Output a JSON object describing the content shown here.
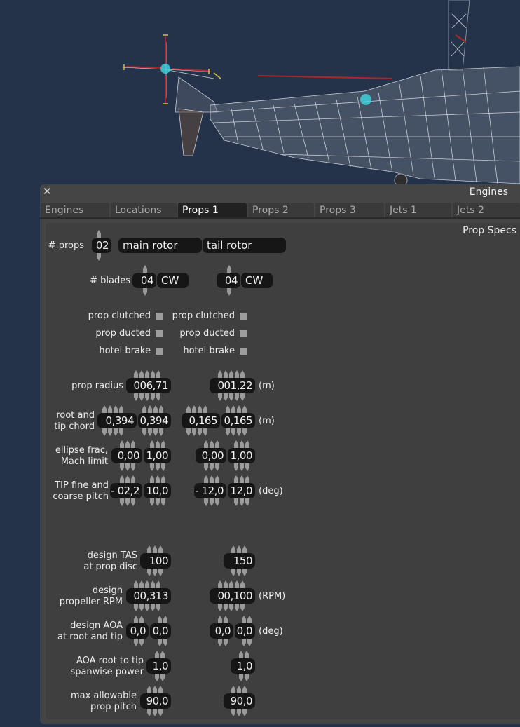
{
  "window": {
    "title": "Engines",
    "close_glyph": "✕"
  },
  "tabs": [
    {
      "label": "Engines",
      "active": false
    },
    {
      "label": "Locations",
      "active": false
    },
    {
      "label": "Props 1",
      "active": true
    },
    {
      "label": "Props 2",
      "active": false
    },
    {
      "label": "Props 3",
      "active": false
    },
    {
      "label": "Jets 1",
      "active": false
    },
    {
      "label": "Jets 2",
      "active": false
    }
  ],
  "panel": {
    "title": "Prop Specs"
  },
  "labels": {
    "num_props": "# props",
    "num_blades": "# blades",
    "prop_clutched": "prop clutched",
    "prop_ducted": "prop ducted",
    "hotel_brake": "hotel brake",
    "prop_radius": "prop radius",
    "chord_1": "root and",
    "chord_2": "tip chord",
    "ellipse_1": "ellipse frac,",
    "ellipse_2": "Mach limit",
    "pitch_1": "TIP fine and",
    "pitch_2": "coarse pitch",
    "tas_1": "design TAS",
    "tas_2": "at prop disc",
    "rpm_1": "design",
    "rpm_2": "propeller RPM",
    "aoa_1": "design AOA",
    "aoa_2": "at root and tip",
    "power_1": "AOA root to tip",
    "power_2": "spanwise power",
    "maxp_1": "max allowable",
    "maxp_2": "prop pitch"
  },
  "units": {
    "m1": "(m)",
    "m2": "(m)",
    "deg1": "(deg)",
    "rpm": "(RPM)",
    "deg2": "(deg)"
  },
  "num_props": "02",
  "props": [
    {
      "name": "main rotor",
      "blades": "04",
      "direction": "CW",
      "clutched": false,
      "ducted": false,
      "hotel_brake": false,
      "radius": "006,71",
      "root_chord": "0,394",
      "tip_chord": "0,394",
      "ellipse_frac": "0,00",
      "mach_limit": "1,00",
      "fine_pitch": "- 02,2",
      "coarse_pitch": "10,0",
      "design_tas": "100",
      "design_rpm": "00,313",
      "aoa_root": "0,0",
      "aoa_tip": "0,0",
      "spanwise_power": "1,0",
      "max_pitch": "90,0"
    },
    {
      "name": "tail rotor",
      "blades": "04",
      "direction": "CW",
      "clutched": false,
      "ducted": false,
      "hotel_brake": false,
      "radius": "001,22",
      "root_chord": "0,165",
      "tip_chord": "0,165",
      "ellipse_frac": "0,00",
      "mach_limit": "1,00",
      "fine_pitch": "- 12,0",
      "coarse_pitch": "12,0",
      "design_tas": "150",
      "design_rpm": "00,100",
      "aoa_root": "0,0",
      "aoa_tip": "0,0",
      "spanwise_power": "1,0",
      "max_pitch": "90,0"
    }
  ],
  "colors": {
    "background": "#25334a",
    "window": "#454545",
    "panel": "#3f3f3f",
    "field": "#161616",
    "wireframe": "#c9ced6",
    "highlight": "#a8272a",
    "accent": "#3fd6e0"
  }
}
